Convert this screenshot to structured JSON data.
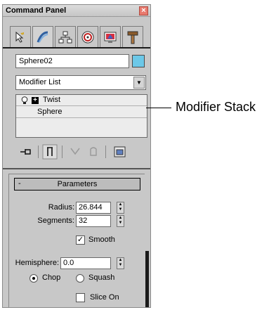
{
  "panel": {
    "title": "Command Panel",
    "close_glyph": "×"
  },
  "tabs": [
    {
      "name": "create-tab",
      "icon": "arrow-cursor-icon"
    },
    {
      "name": "modify-tab",
      "icon": "modify-curve-icon",
      "active": true
    },
    {
      "name": "hierarchy-tab",
      "icon": "hierarchy-icon"
    },
    {
      "name": "motion-tab",
      "icon": "motion-wheel-icon"
    },
    {
      "name": "display-tab",
      "icon": "display-monitor-icon"
    },
    {
      "name": "utilities-tab",
      "icon": "hammer-icon"
    }
  ],
  "object": {
    "name": "Sphere02",
    "color": "#6cc8e8"
  },
  "modifier_list": {
    "selected": "Modifier List"
  },
  "stack": {
    "items": [
      {
        "label": "Twist",
        "expand": "+"
      },
      {
        "label": "Sphere"
      }
    ]
  },
  "parameters": {
    "header": "Parameters",
    "collapse": "-",
    "radius_label": "Radius:",
    "radius": "26.844",
    "segments_label": "Segments:",
    "segments": "32",
    "smooth_label": "Smooth",
    "smooth_checked": "✓",
    "hemisphere_label": "Hemisphere:",
    "hemisphere": "0.0",
    "chop_label": "Chop",
    "squash_label": "Squash",
    "slice_label": "Slice On",
    "spinner_up": "▲",
    "spinner_down": "▼"
  },
  "annotation": {
    "text": "Modifier Stack"
  }
}
